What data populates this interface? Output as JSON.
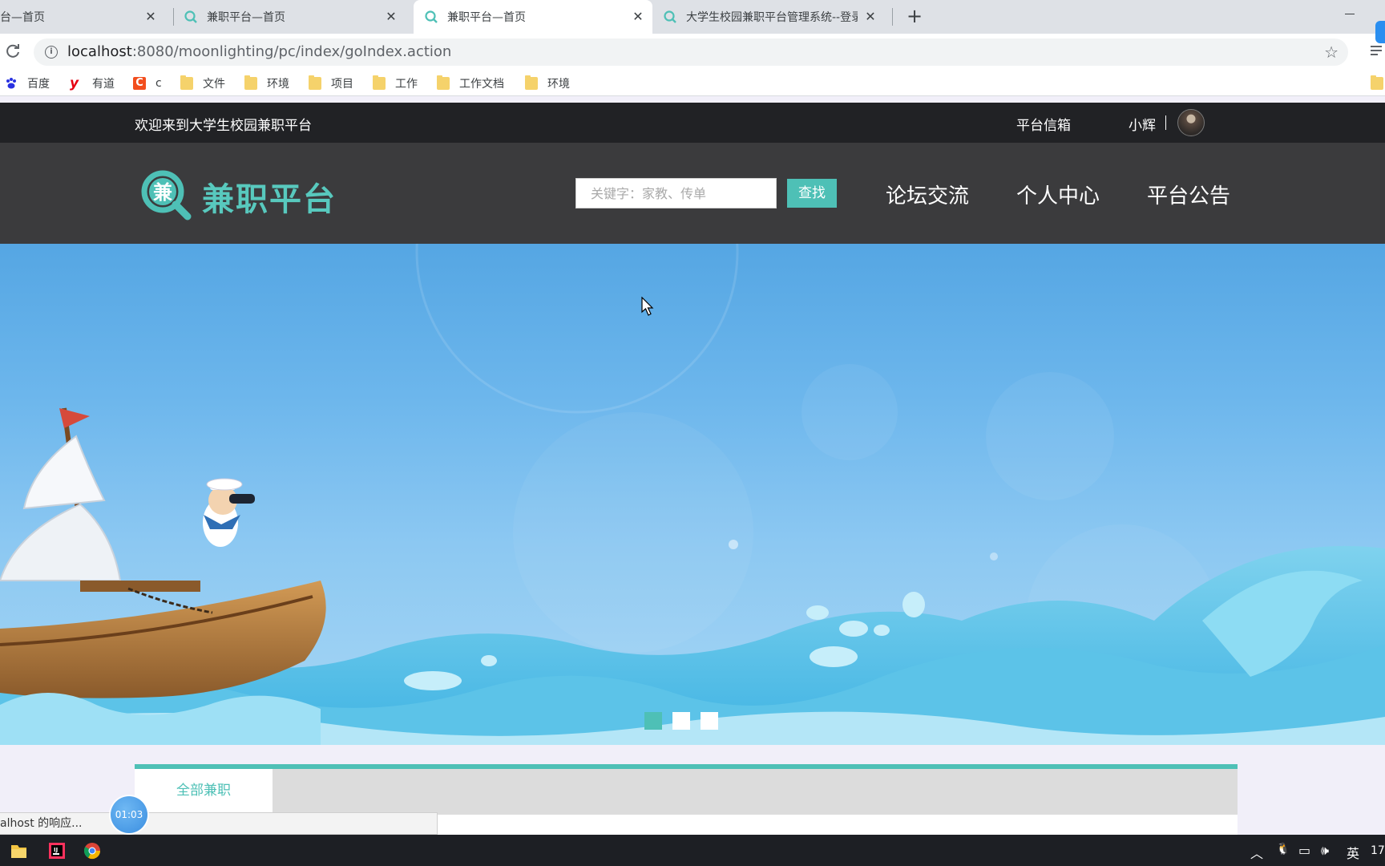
{
  "browser": {
    "tabs": [
      {
        "title": "平台—首页"
      },
      {
        "title": "兼职平台—首页"
      },
      {
        "title": "兼职平台—首页"
      },
      {
        "title": "大学生校园兼职平台管理系统--登录"
      }
    ],
    "url_host": "localhost",
    "url_path": ":8080/moonlighting/pc/index/goIndex.action",
    "bookmarks": [
      {
        "label": "百度",
        "icon": "baidu-icon"
      },
      {
        "label": "有道",
        "icon": "youdao-icon"
      },
      {
        "label": "c",
        "icon": "c-icon"
      },
      {
        "label": "文件",
        "icon": "folder-icon"
      },
      {
        "label": "环境",
        "icon": "folder-icon"
      },
      {
        "label": "项目",
        "icon": "folder-icon"
      },
      {
        "label": "工作",
        "icon": "folder-icon"
      },
      {
        "label": "工作文档",
        "icon": "folder-icon"
      },
      {
        "label": "环境",
        "icon": "folder-icon"
      }
    ],
    "status_text": "alhost 的响应..."
  },
  "site": {
    "welcome": "欢迎来到大学生校园兼职平台",
    "mailbox": "平台信箱",
    "username": "小辉",
    "logo_glyph": "兼",
    "logo_text": "兼职平台",
    "search_placeholder": "关键字：家教、传单",
    "search_button": "查找",
    "nav": [
      "论坛交流",
      "个人中心",
      "平台公告"
    ],
    "carousel_total": 3,
    "carousel_active": 1,
    "category_tab": "全部兼职"
  },
  "overlay": {
    "timer": "01:03"
  },
  "taskbar": {
    "ime": "英",
    "clock": "17"
  },
  "colors": {
    "accent": "#4ec0b6",
    "topbar": "#212225",
    "header": "#3b3b3d"
  }
}
